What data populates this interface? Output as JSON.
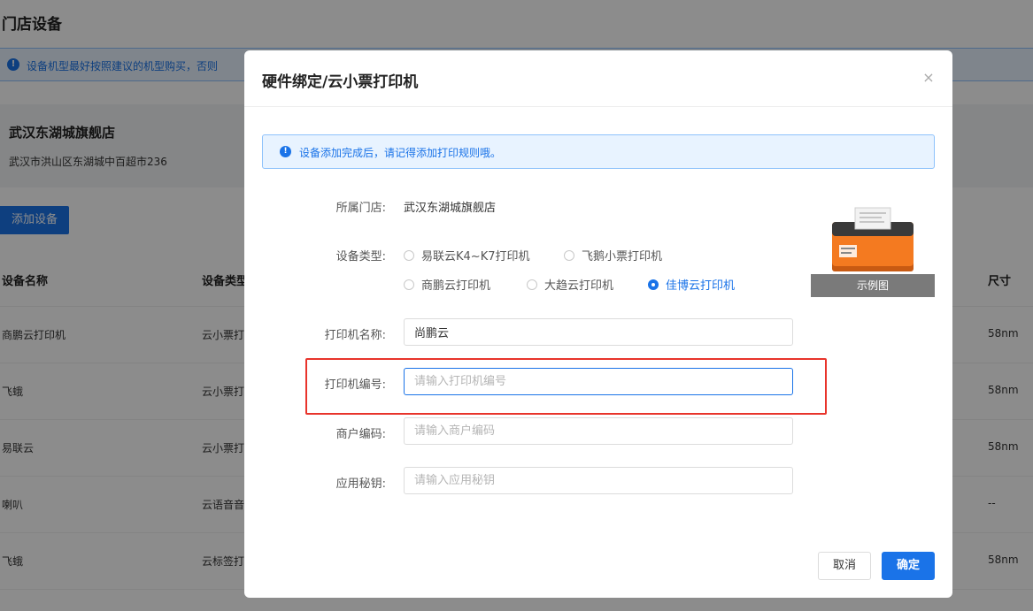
{
  "page": {
    "title": "门店设备",
    "notice": "设备机型最好按照建议的机型购买，否则",
    "store": {
      "name": "武汉东湖城旗舰店",
      "address": "武汉市洪山区东湖城中百超市236"
    },
    "add_button": "添加设备",
    "table": {
      "headers": {
        "name": "设备名称",
        "type": "设备类型",
        "size": "尺寸"
      },
      "rows": [
        {
          "name": "商鹏云打印机",
          "type": "云小票打",
          "size": "58nm"
        },
        {
          "name": "飞蛾",
          "type": "云小票打",
          "size": "58nm"
        },
        {
          "name": "易联云",
          "type": "云小票打",
          "size": "58nm"
        },
        {
          "name": "喇叭",
          "type": "云语音音",
          "size": "--"
        },
        {
          "name": "飞蛾",
          "type": "云标签打",
          "size": "58nm"
        }
      ]
    }
  },
  "modal": {
    "title": "硬件绑定/云小票打印机",
    "close": "×",
    "alert": "设备添加完成后，请记得添加打印规则哦。",
    "fields": {
      "store_label": "所属门店:",
      "store_value": "武汉东湖城旗舰店",
      "type_label": "设备类型:",
      "types": [
        "易联云K4~K7打印机",
        "飞鹅小票打印机",
        "商鹏云打印机",
        "大趋云打印机",
        "佳博云打印机"
      ],
      "selected_type": "佳博云打印机",
      "printer_name_label": "打印机名称:",
      "printer_name_value": "尚鹏云",
      "printer_sn_label": "打印机编号:",
      "printer_sn_placeholder": "请输入打印机编号",
      "merchant_code_label": "商户编码:",
      "merchant_code_placeholder": "请输入商户编码",
      "app_secret_label": "应用秘钥:",
      "app_secret_placeholder": "请输入应用秘钥"
    },
    "example_caption": "示例图",
    "cancel": "取消",
    "confirm": "确定"
  },
  "colors": {
    "primary": "#1a73e8",
    "highlight": "#e8342b",
    "printer_orange": "#f47a20"
  }
}
